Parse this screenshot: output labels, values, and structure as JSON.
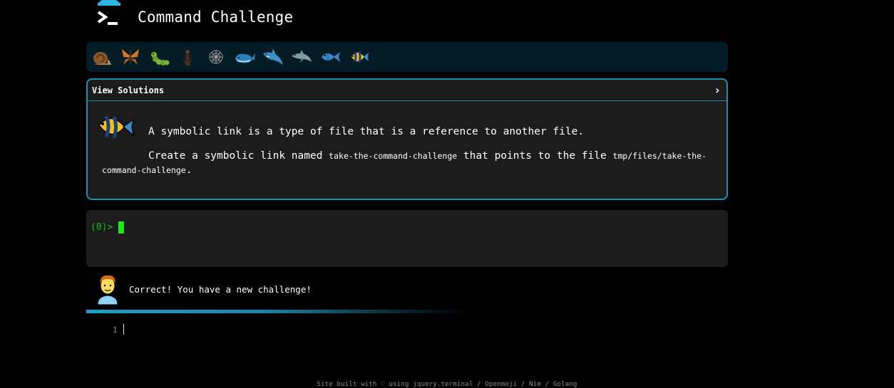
{
  "header": {
    "title": "Command Challenge",
    "logo_icon": "terminal-prompt-icon"
  },
  "badges": [
    {
      "name": "snail-icon"
    },
    {
      "name": "butterfly-icon"
    },
    {
      "name": "caterpillar-icon"
    },
    {
      "name": "ant-icon"
    },
    {
      "name": "spider-web-icon"
    },
    {
      "name": "whale-icon"
    },
    {
      "name": "shark-icon"
    },
    {
      "name": "dolphin-icon"
    },
    {
      "name": "fish-icon"
    },
    {
      "name": "tropical-fish-icon"
    }
  ],
  "panel": {
    "toggle_label": "View Solutions",
    "chevron": "›",
    "description": "A symbolic link is a type of file that is a reference to another file.",
    "task_prefix": "Create a symbolic link named ",
    "task_link_name": "take-the-command-challenge",
    "task_middle": " that points to the file ",
    "task_target": "tmp/files/take-the-command-challenge",
    "task_suffix": "."
  },
  "terminal": {
    "prompt": "(0)>"
  },
  "message": {
    "text": "Correct! You have a new challenge!"
  },
  "editor": {
    "line_number": "1"
  },
  "footer": {
    "text": "Site built with ♡ using jquery.terminal / Openmoji / Nim / Golang"
  },
  "colors": {
    "accent": "#1c8fb0",
    "prompt": "#1fc01f",
    "panel_bg": "#1c1c1c",
    "badge_bg": "#041c26"
  }
}
